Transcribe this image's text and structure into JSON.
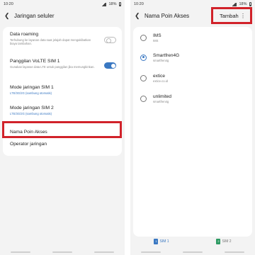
{
  "status": {
    "left_time": "10:20",
    "right_time": "10:20",
    "battery_left": "18%",
    "battery_right": "18%"
  },
  "left": {
    "title": "Jaringan seluler",
    "items": [
      {
        "title": "Data roaming",
        "sub": "Terhubung ke layanan data saat jelajah dapat mengakibatkan biaya tambahan."
      },
      {
        "title": "Panggilan VoLTE SIM 1",
        "sub": "Gunakan layanan data LTE untuk panggilan jika memungkinkan."
      },
      {
        "title": "Mode jaringan SIM 1",
        "sub": "LTE/3G/2G (sambung otomatis)"
      },
      {
        "title": "Mode jaringan SIM 2",
        "sub": "LTE/3G/2G (sambung otomatis)"
      },
      {
        "title": "Nama Poin Akses"
      },
      {
        "title": "Operator jaringan"
      }
    ],
    "toggles": {
      "data_roaming": false,
      "volte": true
    }
  },
  "right": {
    "title": "Nama Poin Akses",
    "add_label": "Tambah",
    "apns": [
      {
        "name": "IMS",
        "sub": "IMS",
        "selected": false
      },
      {
        "name": "Smartfren4G",
        "sub": "smartfren4g",
        "selected": true
      },
      {
        "name": "extice",
        "sub": "extice.co.id",
        "selected": false
      },
      {
        "name": "unlimited",
        "sub": "smartfren4g",
        "selected": false
      }
    ],
    "sim_tabs": [
      {
        "label": "SIM 1",
        "color": "#3a78c2",
        "num": "1"
      },
      {
        "label": "SIM 2",
        "color": "#2e9a63",
        "num": "2"
      }
    ]
  },
  "colors": {
    "accent": "#3a78c2",
    "highlight": "#d1222a"
  }
}
